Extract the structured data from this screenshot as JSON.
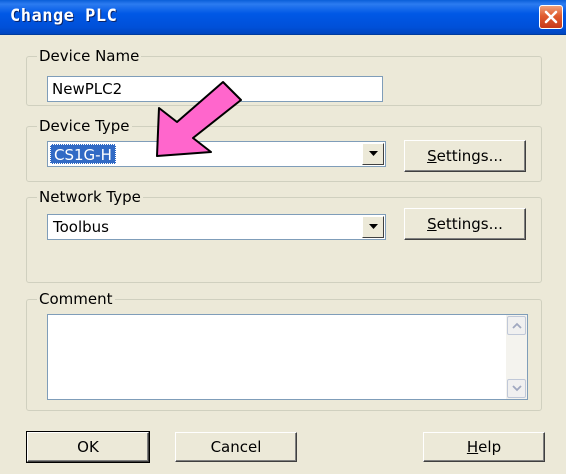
{
  "window": {
    "title": "Change PLC"
  },
  "device_name": {
    "legend": "Device Name",
    "value": "NewPLC2"
  },
  "device_type": {
    "legend": "Device Type",
    "value": "CS1G-H",
    "settings_pre": "S",
    "settings_rest": "ettings..."
  },
  "network_type": {
    "legend": "Network Type",
    "value": "Toolbus",
    "settings_pre": "S",
    "settings_rest": "ettings..."
  },
  "comment": {
    "legend": "Comment",
    "value": ""
  },
  "buttons": {
    "ok": "OK",
    "cancel": "Cancel",
    "help_pre": "H",
    "help_rest": "elp"
  },
  "colors": {
    "titlebar": "#0058E6",
    "selection": "#316AC5",
    "pointer_arrow": "#FF66CC",
    "face": "#ECE9D8"
  },
  "icons": {
    "close": "close-icon",
    "dropdown": "chevron-down-icon",
    "pointer": "arrow-pointer-icon"
  }
}
